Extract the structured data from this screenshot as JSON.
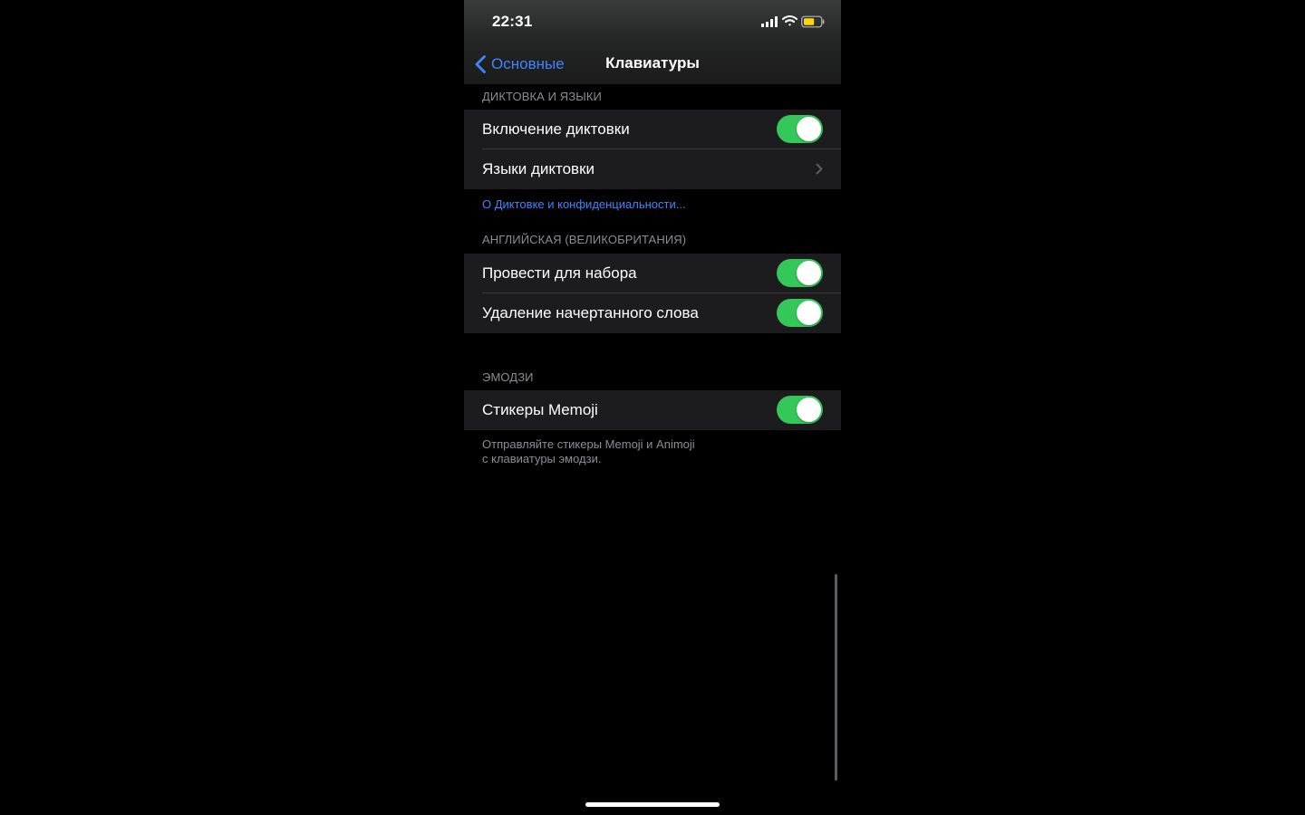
{
  "status_bar": {
    "time": "22:31",
    "icons": [
      "signal-icon",
      "wifi-icon",
      "battery-icon"
    ],
    "battery_color": "#ffd60a"
  },
  "navigation": {
    "back_label": "Основные",
    "title": "Клавиатуры",
    "back_icon": "chevron-left-icon"
  },
  "sections": {
    "dictation": {
      "header": "ДИКТОВКА И ЯЗЫКИ",
      "rows": [
        {
          "label": "Включение диктовки",
          "control": "switch",
          "enabled": true
        },
        {
          "label": "Языки диктовки",
          "control": "disclosure"
        }
      ],
      "footer_link": "О Диктовке и конфиденциальности..."
    },
    "english": {
      "header": "АНГЛИЙСКАЯ (ВЕЛИКОБРИТАНИЯ)",
      "rows": [
        {
          "label": "Провести для набора",
          "control": "switch",
          "enabled": true
        },
        {
          "label": "Удаление начертанного слова",
          "control": "switch",
          "enabled": true
        }
      ]
    },
    "emoji": {
      "header": "ЭМОДЗИ",
      "rows": [
        {
          "label": "Стикеры Memoji",
          "control": "switch",
          "enabled": true
        }
      ],
      "footer_line_1": "Отправляйте стикеры Memoji и Animoji",
      "footer_line_2": "с клавиатуры эмодзи."
    }
  },
  "colors": {
    "background": "#000000",
    "cell_background": "#1c1c1e",
    "accent_blue": "#3f85ff",
    "switch_green": "#34c759",
    "secondary_text": "#8d8d93"
  }
}
